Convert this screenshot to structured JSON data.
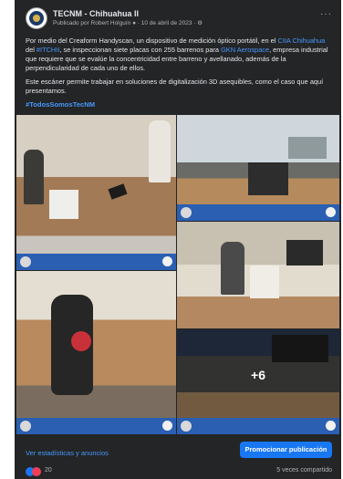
{
  "post": {
    "page_name": "TECNM - Chihuahua II",
    "meta": "Publicado por Robert Holguín ● · 10 de abril de 2023 · ⚙",
    "more": "···",
    "paragraph1": {
      "t1": "Por medio del Creaform Handyscan, un dispositivo de medición óptico portátil, en el ",
      "link1": "CIIA Chihuahua",
      "t2": " del ",
      "link2": "#ITCHII",
      "t3": ", se inspeccionan siete placas con 255 barrenos para ",
      "link3": "GKN Aerospace",
      "t4": ", empresa industrial que requiere que se evalúe la concentricidad entre barreno y avellanado, además de la perpendicularidad de cada uno de ellos."
    },
    "paragraph2": "Este escáner permite trabajar en soluciones de digitalización 3D asequibles, como el caso que aquí presentamos.",
    "hashtag": "#TodosSomosTecNM",
    "more_photos": "+6"
  },
  "footer": {
    "stats_link": "Ver estadísticas y anuncios",
    "promote_button": "Promocionar publicación"
  },
  "reactions": {
    "count": "20",
    "shares": "5 veces compartido"
  },
  "colors": {
    "card_bg": "#242526",
    "link": "#4599ff",
    "primary_button": "#1877f2",
    "banner": "#2a5fb2"
  }
}
